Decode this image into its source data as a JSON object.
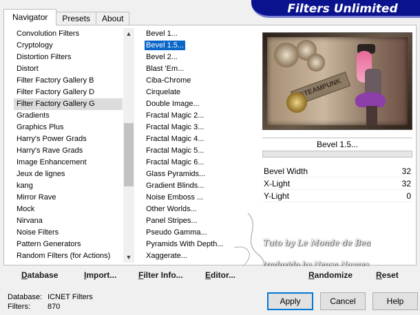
{
  "header": {
    "brand": "Filters Unlimited"
  },
  "tabs": [
    "Navigator",
    "Presets",
    "About"
  ],
  "categories": [
    "Convolution Filters",
    "Cryptology",
    "Distortion Filters",
    "Distort",
    "Filter Factory Gallery B",
    "Filter Factory Gallery D",
    "Filter Factory Gallery G",
    "Gradients",
    "Graphics Plus",
    "Harry's Power Grads",
    "Harry's Rave Grads",
    "Image Enhancement",
    "Jeux de lignes",
    "kang",
    "Mirror Rave",
    "Mock",
    "Nirvana",
    "Noise Filters",
    "Pattern Generators",
    "Random Filters (for Actions)"
  ],
  "selected_category": "Filter Factory Gallery G",
  "filters": [
    "Bevel 1...",
    "Bevel 1.5...",
    "Bevel 2...",
    "Blast 'Em...",
    "Ciba-Chrome",
    "Cirquelate",
    "Double Image...",
    "Fractal Magic 2...",
    "Fractal Magic 3...",
    "Fractal Magic 4...",
    "Fractal Magic 5...",
    "Fractal Magic 6...",
    "Glass Pyramids...",
    "Gradient Blinds...",
    "Noise Emboss ...",
    "Other Worlds...",
    "Panel Stripes...",
    "Pseudo Gamma...",
    "Pyramids With Depth...",
    "Xaggerate..."
  ],
  "selected_filter": "Bevel 1.5...",
  "preview": {
    "caption": "Bevel 1.5...",
    "image_text": "STEAMPUNK"
  },
  "parameters": [
    {
      "name": "Bevel Width",
      "value": "32"
    },
    {
      "name": "X-Light",
      "value": "32"
    },
    {
      "name": "Y-Light",
      "value": "0"
    }
  ],
  "watermark": {
    "line1": "Tuto by Le Monde de Bea",
    "line2": "traduzido by Neusa Novaes"
  },
  "toolbar": {
    "database": "Database",
    "import": "Import...",
    "filter_info": "Filter Info...",
    "editor": "Editor...",
    "randomize": "Randomize",
    "reset": "Reset"
  },
  "info": {
    "database_label": "Database:",
    "database_value": "ICNET Filters",
    "filters_label": "Filters:",
    "filters_value": "870"
  },
  "buttons": {
    "apply": "Apply",
    "cancel": "Cancel",
    "help": "Help"
  },
  "colors": {
    "brand_bg": "#0b128e",
    "selection": "#0a66c8"
  }
}
